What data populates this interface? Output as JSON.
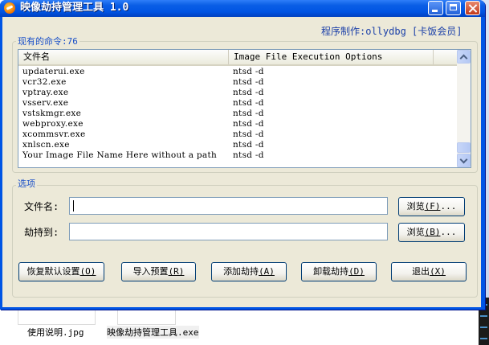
{
  "window": {
    "title": "映像劫持管理工具 1.0",
    "maker_label": "程序制作:ollydbg [卡饭会员]"
  },
  "commands_group": {
    "label": "现有的命令:76",
    "columns": [
      "文件名",
      "Image File Execution Options"
    ],
    "rows": [
      [
        "updaterui.exe",
        "ntsd -d"
      ],
      [
        "vcr32.exe",
        "ntsd -d"
      ],
      [
        "vptray.exe",
        "ntsd -d"
      ],
      [
        "vsserv.exe",
        "ntsd -d"
      ],
      [
        "vstskmgr.exe",
        "ntsd -d"
      ],
      [
        "webproxy.exe",
        "ntsd -d"
      ],
      [
        "xcommsvr.exe",
        "ntsd -d"
      ],
      [
        "xnlscn.exe",
        "ntsd -d"
      ],
      [
        "Your Image File Name Here without a path",
        "ntsd -d"
      ]
    ]
  },
  "options_group": {
    "label": "选项",
    "filename_label": "文件名:",
    "filename_value": "",
    "hijack_label": "劫持到:",
    "hijack_value": "",
    "browse1": {
      "text": "浏览",
      "key": "(F)",
      "dots": "..."
    },
    "browse2": {
      "text": "浏览",
      "key": "(B)",
      "dots": "..."
    }
  },
  "actions": [
    {
      "text": "恢复默认设置",
      "key": "(O)"
    },
    {
      "text": "导入预置",
      "key": "(R)"
    },
    {
      "text": "添加劫持",
      "key": "(A)"
    },
    {
      "text": "卸载劫持",
      "key": "(D)"
    },
    {
      "text": "退出",
      "key": "(X)"
    }
  ],
  "desktop": {
    "files": [
      "使用说明.jpg",
      "映像劫持管理工具.exe"
    ]
  }
}
